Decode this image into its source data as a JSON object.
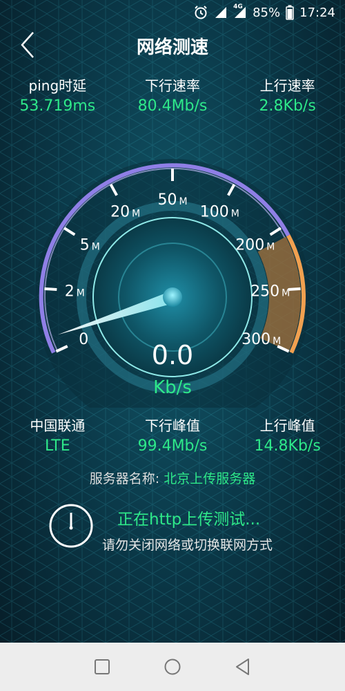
{
  "status_bar": {
    "network": "4G",
    "battery": "85%",
    "time": "17:24",
    "icons": [
      "alarm-icon",
      "signal-icon",
      "signal-4g-icon",
      "battery-icon"
    ]
  },
  "header": {
    "title": "网络测速",
    "back_icon": "chevron-left-icon"
  },
  "top_stats": [
    {
      "label": "ping时延",
      "value": "53.719ms"
    },
    {
      "label": "下行速率",
      "value": "80.4Mb/s"
    },
    {
      "label": "上行速率",
      "value": "2.8Kb/s"
    }
  ],
  "gauge": {
    "ticks": [
      {
        "value": "0",
        "unit": ""
      },
      {
        "value": "2",
        "unit": "M"
      },
      {
        "value": "5",
        "unit": "M"
      },
      {
        "value": "20",
        "unit": "M"
      },
      {
        "value": "50",
        "unit": "M"
      },
      {
        "value": "100",
        "unit": "M"
      },
      {
        "value": "200",
        "unit": "M"
      },
      {
        "value": "250",
        "unit": "M"
      },
      {
        "value": "300",
        "unit": "M"
      }
    ],
    "needle_fraction": 0.03,
    "accent_color": "#2ee889",
    "ring_color": "#8f7fe6",
    "highlight_color": "#f0a050"
  },
  "readout": {
    "value": "0.0",
    "unit": "Kb/s"
  },
  "bottom_stats": [
    {
      "label": "中国联通",
      "value": "LTE"
    },
    {
      "label": "下行峰值",
      "value": "99.4Mb/s"
    },
    {
      "label": "上行峰值",
      "value": "14.8Kb/s"
    }
  ],
  "server": {
    "label": "服务器名称:",
    "name": "北京上传服务器"
  },
  "status": {
    "main": "正在http上传测试...",
    "sub": "请勿关闭网络或切换联网方式",
    "icon": "clock-icon"
  },
  "navbar": {
    "icons": [
      "recent-apps-icon",
      "home-icon",
      "back-icon"
    ]
  }
}
